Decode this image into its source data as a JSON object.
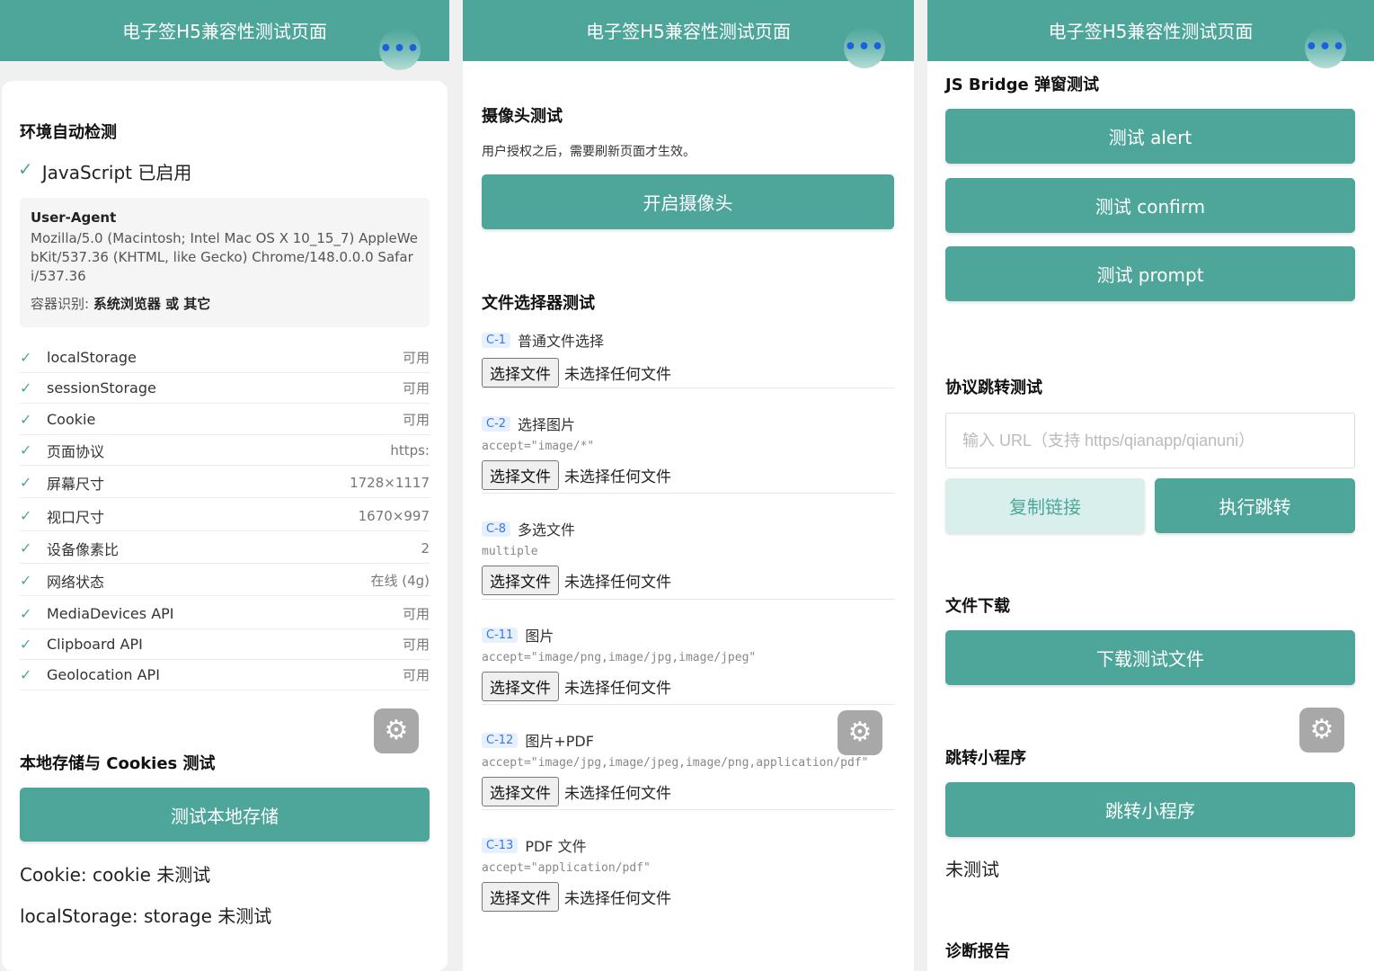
{
  "app": {
    "title": "电子签H5兼容性测试页面",
    "more_label": "•••",
    "settings_icon": "settings-icon",
    "more_icon": "more-icon"
  },
  "colors": {
    "primary": "#4ea69b",
    "primary_light": "#d9efec",
    "tag_bg": "#e6f0ff",
    "tag_text": "#3a78e0"
  },
  "env": {
    "title": "环境自动检测",
    "check_mark": "✓",
    "js_status": "JavaScript 已启用",
    "ua_label": "User-Agent",
    "ua_value": "Mozilla/5.0 (Macintosh; Intel Mac OS X 10_15_7) AppleWebKit/537.36 (KHTML, like Gecko) Chrome/148.0.0.0 Safari/537.36",
    "container_label": "容器识别:",
    "container_value": "系统浏览器 或 其它",
    "rows": [
      {
        "name": "localStorage",
        "value": "可用"
      },
      {
        "name": "sessionStorage",
        "value": "可用"
      },
      {
        "name": "Cookie",
        "value": "可用"
      },
      {
        "name": "页面协议",
        "value": "https:"
      },
      {
        "name": "屏幕尺寸",
        "value": "1728×1117"
      },
      {
        "name": "视口尺寸",
        "value": "1670×997"
      },
      {
        "name": "设备像素比",
        "value": "2"
      },
      {
        "name": "网络状态",
        "value": "在线 (4g)"
      },
      {
        "name": "MediaDevices API",
        "value": "可用"
      },
      {
        "name": "Clipboard API",
        "value": "可用"
      },
      {
        "name": "Geolocation API",
        "value": "可用"
      }
    ]
  },
  "storage": {
    "title": "本地存储与 Cookies 测试",
    "button": "测试本地存储",
    "cookie_status": "Cookie: cookie 未测试",
    "local_status": "localStorage: storage 未测试"
  },
  "camera": {
    "title": "摄像头测试",
    "note": "用户授权之后，需要刷新页面才生效。",
    "button": "开启摄像头"
  },
  "file_picker": {
    "title": "文件选择器测试",
    "choose_label": "选择文件",
    "no_file_label": "未选择任何文件",
    "items": [
      {
        "tag": "C-1",
        "label": "普通文件选择",
        "accept": ""
      },
      {
        "tag": "C-2",
        "label": "选择图片",
        "accept": "accept=\"image/*\""
      },
      {
        "tag": "C-8",
        "label": "多选文件",
        "accept": "multiple"
      },
      {
        "tag": "C-11",
        "label": "图片",
        "accept": "accept=\"image/png,image/jpg,image/jpeg\""
      },
      {
        "tag": "C-12",
        "label": "图片+PDF",
        "accept": "accept=\"image/jpg,image/jpeg,image/png,application/pdf\""
      },
      {
        "tag": "C-13",
        "label": "PDF 文件",
        "accept": "accept=\"application/pdf\""
      }
    ]
  },
  "bridge": {
    "title": "JS Bridge 弹窗测试",
    "alert": "测试 alert",
    "confirm": "测试 confirm",
    "prompt": "测试 prompt"
  },
  "protocol": {
    "title": "协议跳转测试",
    "placeholder": "输入 URL（支持 https/qianapp/qianuni）",
    "copy": "复制链接",
    "go": "执行跳转"
  },
  "download": {
    "title": "文件下载",
    "button": "下载测试文件"
  },
  "miniprogram": {
    "title": "跳转小程序",
    "button": "跳转小程序",
    "status": "未测试"
  },
  "report": {
    "title": "诊断报告"
  }
}
